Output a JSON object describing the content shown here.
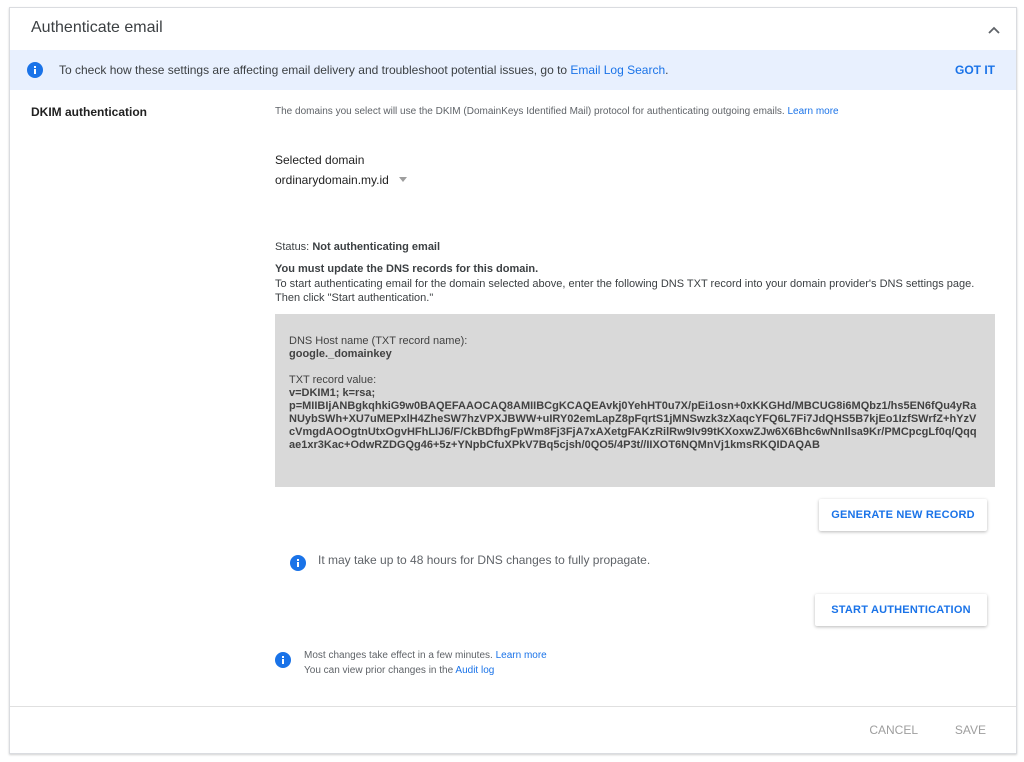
{
  "header": {
    "title": "Authenticate email",
    "icon": "chevron-up-icon"
  },
  "banner": {
    "text": "To check how these settings are affecting email delivery and troubleshoot potential issues, go to",
    "link": "Email Log Search",
    "period": ".",
    "dismiss": "GOT IT",
    "icon": "info-icon",
    "color": "#e8f0fe"
  },
  "section": {
    "label": "DKIM authentication"
  },
  "content": {
    "description": "The domains you select will use the DKIM (DomainKeys Identified Mail) protocol for authenticating outgoing emails.",
    "description_link": "Learn more",
    "selected_domain_label": "Selected domain",
    "selected_domain_value": "ordinarydomain.my.id",
    "status_label": "Status:",
    "status_value": "Not authenticating email",
    "must_update": "You must update the DNS records for this domain.",
    "instructions": "To start authenticating email for the domain selected above, enter the following DNS TXT record into your domain provider's DNS settings page. Then click \"Start authentication.\"",
    "dns": {
      "host_label": "DNS Host name (TXT record name):",
      "host_value": "google._domainkey",
      "record_label": "TXT record value:",
      "record_line1": "v=DKIM1; k=rsa;",
      "record_value": "p=MIIBIjANBgkqhkiG9w0BAQEFAAOCAQ8AMIIBCgKCAQEAvkj0YehHT0u7X/pEi1osn+0xKKGHd/MBCUG8i6MQbz1/hs5EN6fQu4yRaNUybSWh+XU7uMEPxlH4ZheSW7hzVPXJBWW+uIRY02emLapZ8pFqrtS1jMNSwzk3zXaqcYFQ6L7Fi7JdQHS5B7kjEo1IzfSWrfZ+hYzVcVmgdAOOgtnUtxOgvHFhLIJ6/F/CkBDfhgFpWm8Fj3FjA7xAXetgFAKzRilRw9Iv99tKXoxwZJw6X6Bhc6wNnIlsa9Kr/PMCpcgLf0q/Qqqae1xr3Kac+OdwRZDGQg46+5z+YNpbCfuXPkV7Bq5cjsh/0QO5/4P3t//IIXOT6NQMnVj1kmsRKQIDAQAB",
      "background": "#d9d9d9"
    },
    "generate_button": "GENERATE NEW RECORD",
    "propagation_note": "It may take up to 48 hours for DNS changes to fully propagate.",
    "start_button": "START AUTHENTICATION",
    "changes_note": "Most changes take effect in a few minutes.",
    "changes_link": "Learn more",
    "audit_note": "You can view prior changes in the",
    "audit_link": "Audit log"
  },
  "footer": {
    "cancel": "CANCEL",
    "save": "SAVE"
  },
  "colors": {
    "accent": "#1a73e8",
    "disabled": "#9e9e9e"
  }
}
